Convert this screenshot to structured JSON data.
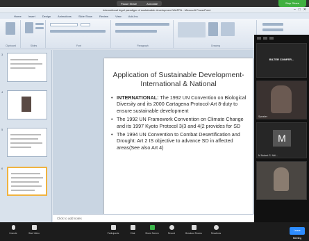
{
  "zoom_top": {
    "share_labels": [
      "Pause Share",
      "Annotate"
    ],
    "green_button": "Stop Share"
  },
  "powerpoint": {
    "window_title": "International legal paradigm of sustainable development WAPPA  -  Microsoft PowerPoint",
    "tabs": [
      "Home",
      "Insert",
      "Design",
      "Animations",
      "Slide Show",
      "Review",
      "View",
      "Add-Ins"
    ],
    "ribbon_groups": [
      "Clipboard",
      "Slides",
      "Font",
      "Paragraph",
      "Drawing",
      "Editing"
    ],
    "notes_placeholder": "Click to add notes"
  },
  "thumbnails": [
    {
      "number": "3"
    },
    {
      "number": "4"
    },
    {
      "number": "5"
    },
    {
      "number": "6"
    }
  ],
  "slide": {
    "title": "Application of Sustainable Development-International & National",
    "bullets": [
      {
        "label": "INTERNATIONAL:",
        "text": " The 1992 UN Convention on Biological Diversity and its 2000 Cartagena Protocol-Art 8-duty to ensure sustainable development"
      },
      {
        "label": "",
        "text": "The 1992 UN Framework Convention on Climate Change and its 1997 Kyoto Protocol 3(3 and 4(2 provides for SD"
      },
      {
        "label": "",
        "text": " The 1994 UN Convention to Combat Desertification and Drought: Art 2 IS objective to advance SD in affected areas(See also Art 4)"
      }
    ]
  },
  "video_panel": {
    "tiles": [
      {
        "name": "",
        "center_text": "BILTER CONFER..."
      },
      {
        "name": "Speaker",
        "center_text": ""
      },
      {
        "name": "M Nobert S. Ndi...",
        "center_text": ""
      },
      {
        "name": "",
        "center_text": ""
      }
    ],
    "avatar_letter": "M"
  },
  "zoom_toolbar": {
    "buttons": [
      "Unmute",
      "Start Video",
      "Participants",
      "Chat",
      "Share Screen",
      "Record",
      "Breakout Rooms",
      "Reactions"
    ],
    "leave_label": "Leave Meeting"
  }
}
